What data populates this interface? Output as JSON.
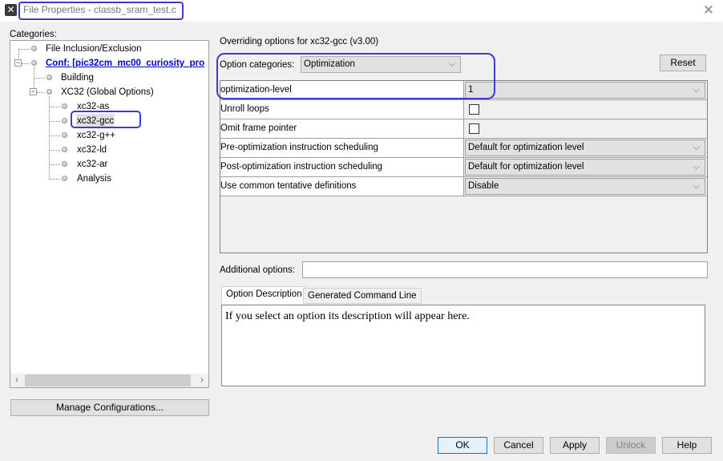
{
  "window": {
    "title": "File Properties - classb_sram_test.c",
    "app_icon": "x-logo-icon",
    "close_icon": "close-icon"
  },
  "categories": {
    "label": "Categories:",
    "tree": [
      {
        "label": "File Inclusion/Exclusion",
        "level": 0
      },
      {
        "label": "Conf: [pic32cm_mc00_curiosity_pro",
        "level": 0,
        "expanded": true,
        "link": true
      },
      {
        "label": "Building",
        "level": 1
      },
      {
        "label": "XC32 (Global Options)",
        "level": 1,
        "expanded": true
      },
      {
        "label": "xc32-as",
        "level": 2
      },
      {
        "label": "xc32-gcc",
        "level": 2,
        "selected": true
      },
      {
        "label": "xc32-g++",
        "level": 2
      },
      {
        "label": "xc32-ld",
        "level": 2
      },
      {
        "label": "xc32-ar",
        "level": 2
      },
      {
        "label": "Analysis",
        "level": 2
      }
    ],
    "scroll_left": "‹",
    "scroll_right": "›"
  },
  "manage_button": "Manage Configurations...",
  "options": {
    "header": "Overriding options for xc32-gcc (v3.00)",
    "category_label": "Option categories:",
    "category_value": "Optimization",
    "reset_label": "Reset",
    "rows": [
      {
        "name": "optimization-level",
        "type": "combo",
        "value": "1"
      },
      {
        "name": "Unroll loops",
        "type": "checkbox",
        "checked": false
      },
      {
        "name": "Omit frame pointer",
        "type": "checkbox",
        "checked": false
      },
      {
        "name": "Pre-optimization instruction scheduling",
        "type": "combo",
        "value": "Default for optimization level"
      },
      {
        "name": "Post-optimization instruction scheduling",
        "type": "combo",
        "value": "Default for optimization level"
      },
      {
        "name": "Use common tentative definitions",
        "type": "combo",
        "value": "Disable"
      }
    ],
    "additional_label": "Additional options:",
    "additional_value": "",
    "tabs": [
      {
        "label": "Option Description",
        "active": true
      },
      {
        "label": "Generated Command Line",
        "active": false
      }
    ],
    "description": "If you select an option its description will appear here."
  },
  "buttons": {
    "ok": "OK",
    "cancel": "Cancel",
    "apply": "Apply",
    "unlock": "Unlock",
    "help": "Help"
  },
  "colors": {
    "annotation": "#3c3cc8",
    "link": "#0000cc",
    "default_button_border": "#0078d7"
  }
}
